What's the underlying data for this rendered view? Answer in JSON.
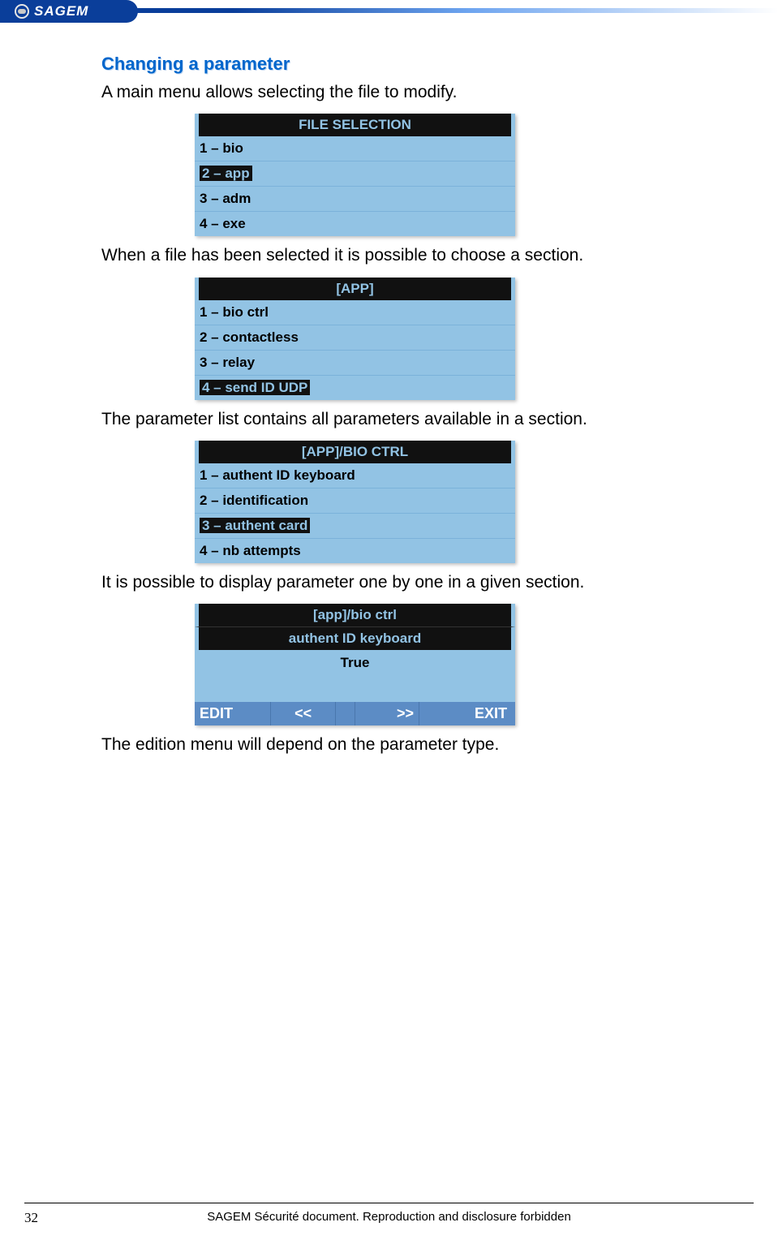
{
  "header": {
    "brand": "SAGEM"
  },
  "section_title": "Changing a parameter",
  "para1": "A main menu allows selecting the file to modify.",
  "menu1": {
    "title": "FILE SELECTION",
    "items": [
      "1 – bio",
      "2 – app",
      "3 – adm",
      "4 – exe"
    ],
    "highlighted_index": 1
  },
  "para2": "When a file has been selected it is possible to choose a section.",
  "menu2": {
    "title": "[APP]",
    "items": [
      "1 – bio ctrl",
      "2 – contactless",
      "3 – relay",
      "4 – send ID UDP"
    ],
    "highlighted_index": 3
  },
  "para3": "The parameter list contains all parameters available in a section.",
  "menu3": {
    "title": "[APP]/BIO CTRL",
    "items": [
      "1 – authent ID keyboard",
      "2 – identification",
      "3 – authent card",
      "4 – nb attempts"
    ],
    "highlighted_index": 2
  },
  "para4": "It is possible to display parameter one by one in a given section.",
  "param_detail": {
    "path": "[app]/bio ctrl",
    "name": "authent ID keyboard",
    "value": "True",
    "buttons": {
      "edit": "EDIT",
      "prev": "<<",
      "next": ">>",
      "exit": "EXIT"
    }
  },
  "para5": "The edition menu will depend on the parameter type.",
  "footer": {
    "page": "32",
    "text": "SAGEM Sécurité document. Reproduction and disclosure forbidden"
  }
}
